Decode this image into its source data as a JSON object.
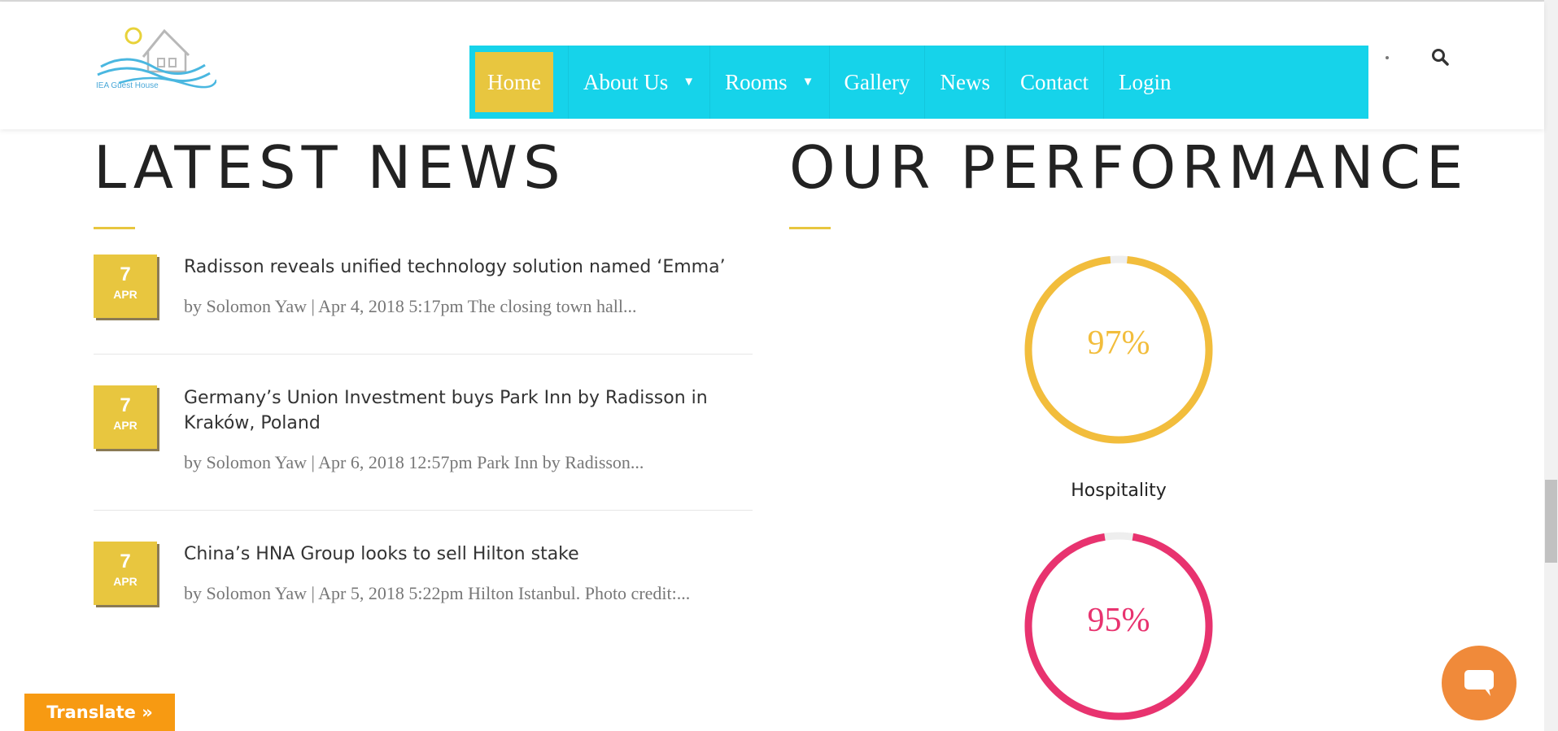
{
  "header": {
    "logo_text": "IEA Guest House",
    "nav": [
      {
        "label": "Home",
        "active": true
      },
      {
        "label": "About Us",
        "dropdown": true
      },
      {
        "label": "Rooms",
        "dropdown": true
      },
      {
        "label": "Gallery"
      },
      {
        "label": "News"
      },
      {
        "label": "Contact"
      },
      {
        "label": "Login"
      }
    ],
    "caret": "▼",
    "search_icon": "search-icon"
  },
  "news": {
    "heading": "LATEST NEWS",
    "items": [
      {
        "day": "7",
        "month": "APR",
        "title": "Radisson reveals unified technology solution named ‘Emma’",
        "meta": "by Solomon Yaw | Apr 4, 2018 5:17pm The closing town hall..."
      },
      {
        "day": "7",
        "month": "APR",
        "title": "Germany’s Union Investment buys Park Inn by Radisson in Kraków, Poland",
        "meta": "by Solomon Yaw | Apr 6, 2018 12:57pm Park Inn by Radisson..."
      },
      {
        "day": "7",
        "month": "APR",
        "title": "China’s HNA Group looks to sell Hilton stake",
        "meta": "by Solomon Yaw | Apr 5, 2018 5:22pm Hilton Istanbul. Photo credit:..."
      }
    ]
  },
  "performance": {
    "heading": "OUR PERFORMANCE",
    "stats": [
      {
        "percent_label": "97%",
        "value": 97,
        "caption": "Hospitality",
        "color": "#f2bd3c"
      },
      {
        "percent_label": "95%",
        "value": 95,
        "caption": "",
        "color": "#e8336f"
      }
    ]
  },
  "colors": {
    "nav_bg": "#16d3ea",
    "accent_yellow": "#e8c63f",
    "translate_orange": "#f79a12",
    "chat_orange": "#f08a3a"
  },
  "widgets": {
    "translate_label": "Translate »",
    "chat_icon": "chat-bubble-icon"
  }
}
